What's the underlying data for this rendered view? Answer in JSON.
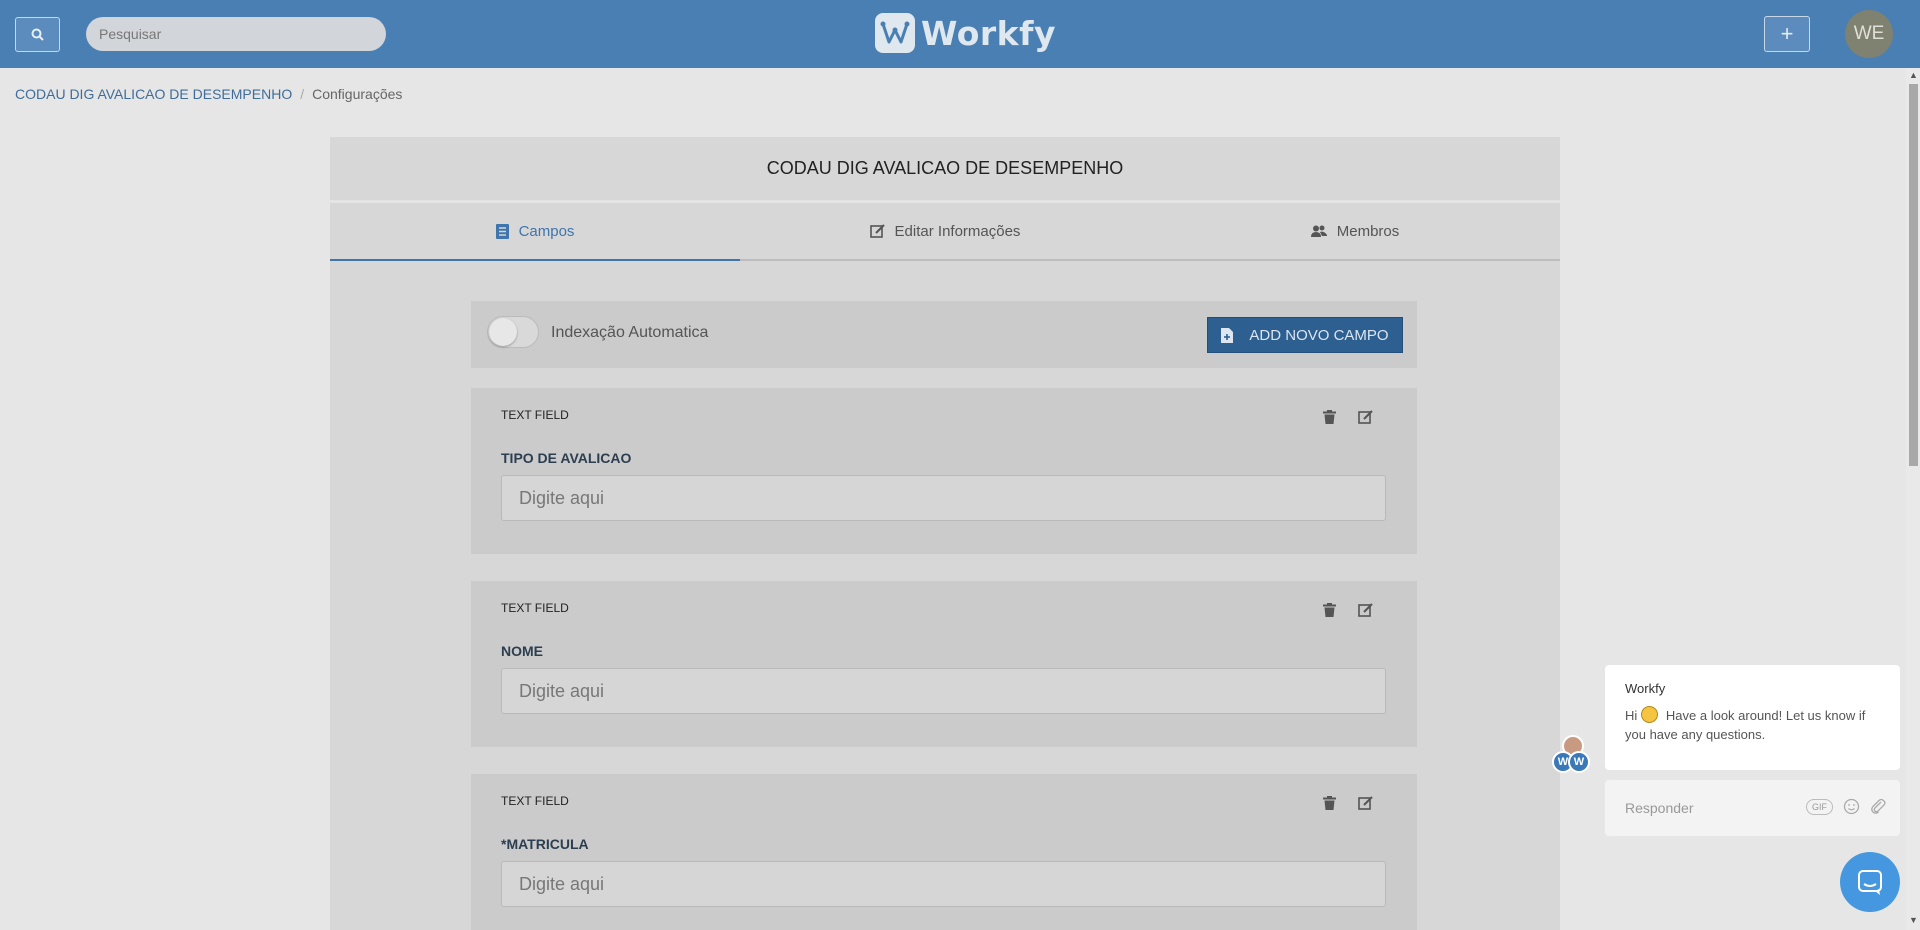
{
  "header": {
    "search_placeholder": "Pesquisar",
    "logo_text": "Workfy",
    "add_label": "+",
    "avatar_initials": "WE"
  },
  "breadcrumb": {
    "items": [
      "CODAU DIG AVALICAO DE DESEMPENHO",
      "Configurações"
    ],
    "separator": "/"
  },
  "card": {
    "title": "CODAU DIG AVALICAO DE DESEMPENHO",
    "tabs": [
      {
        "label": "Campos",
        "icon": "document-icon",
        "active": true
      },
      {
        "label": "Editar Informações",
        "icon": "edit-icon",
        "active": false
      },
      {
        "label": "Membros",
        "icon": "users-icon",
        "active": false
      }
    ],
    "toolbar": {
      "toggle_label": "Indexação Automatica",
      "toggle_on": false,
      "add_field_label": "ADD NOVO CAMPO"
    },
    "fields": [
      {
        "type": "TEXT FIELD",
        "label": "TIPO DE AVALICAO",
        "placeholder": "Digite aqui"
      },
      {
        "type": "TEXT FIELD",
        "label": "NOME",
        "placeholder": "Digite aqui"
      },
      {
        "type": "TEXT FIELD",
        "label": "*MATRICULA",
        "placeholder": "Digite aqui"
      }
    ]
  },
  "chat": {
    "sender": "Workfy",
    "greeting": "Hi",
    "message": "Have a look around! Let us know if you have any questions.",
    "reply_placeholder": "Responder",
    "gif_label": "GIF"
  },
  "colors": {
    "topbar": "#4a7fb3",
    "accent": "#3e75ad",
    "primary_button": "#2d5f91",
    "launcher": "#4598e0"
  }
}
